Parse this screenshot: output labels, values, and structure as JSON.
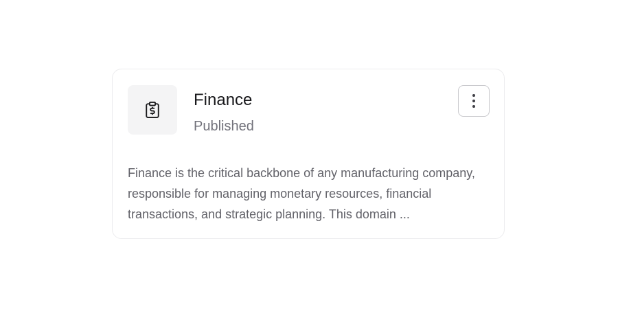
{
  "card": {
    "icon": "clipboard-dollar-icon",
    "title": "Finance",
    "status": "Published",
    "menu_icon": "more-vertical-icon",
    "description": "Finance is the critical backbone of any manufacturing company, responsible for managing monetary resources, financial transactions, and strategic planning. This domain ..."
  },
  "colors": {
    "title": "#18181b",
    "status": "#71717a",
    "description": "#626269",
    "icon_tile_background": "#f4f4f5",
    "card_border": "#ececee"
  }
}
